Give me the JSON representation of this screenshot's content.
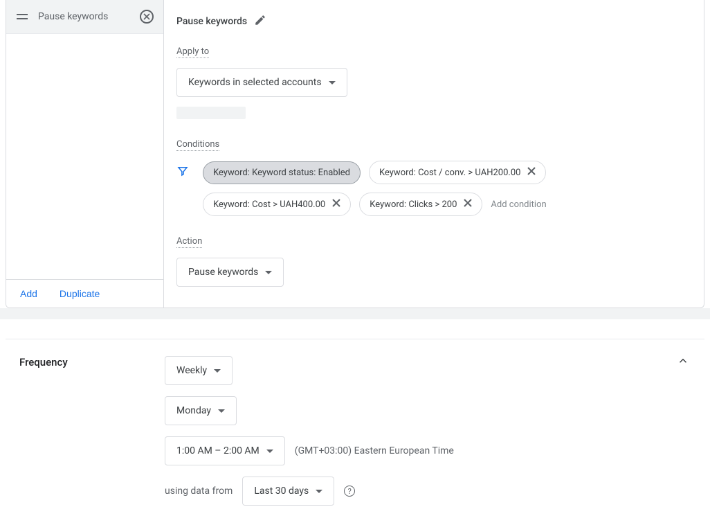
{
  "sidebar": {
    "title": "Pause keywords",
    "add_label": "Add",
    "duplicate_label": "Duplicate"
  },
  "rule": {
    "title": "Pause keywords",
    "apply_to_label": "Apply to",
    "apply_to_value": "Keywords in selected accounts",
    "conditions_label": "Conditions",
    "conditions": [
      {
        "label": "Keyword: Keyword status: Enabled",
        "active": true,
        "removable": false
      },
      {
        "label": "Keyword: Cost / conv. > UAH200.00",
        "active": false,
        "removable": true
      },
      {
        "label": "Keyword: Cost > UAH400.00",
        "active": false,
        "removable": true
      },
      {
        "label": "Keyword: Clicks > 200",
        "active": false,
        "removable": true
      }
    ],
    "add_condition_label": "Add condition",
    "action_label": "Action",
    "action_value": "Pause keywords"
  },
  "frequency": {
    "section_label": "Frequency",
    "period": "Weekly",
    "day": "Monday",
    "time_range": "1:00 AM – 2:00 AM",
    "timezone": "(GMT+03:00) Eastern European Time",
    "data_from_label": "using data from",
    "data_from_value": "Last 30 days"
  }
}
